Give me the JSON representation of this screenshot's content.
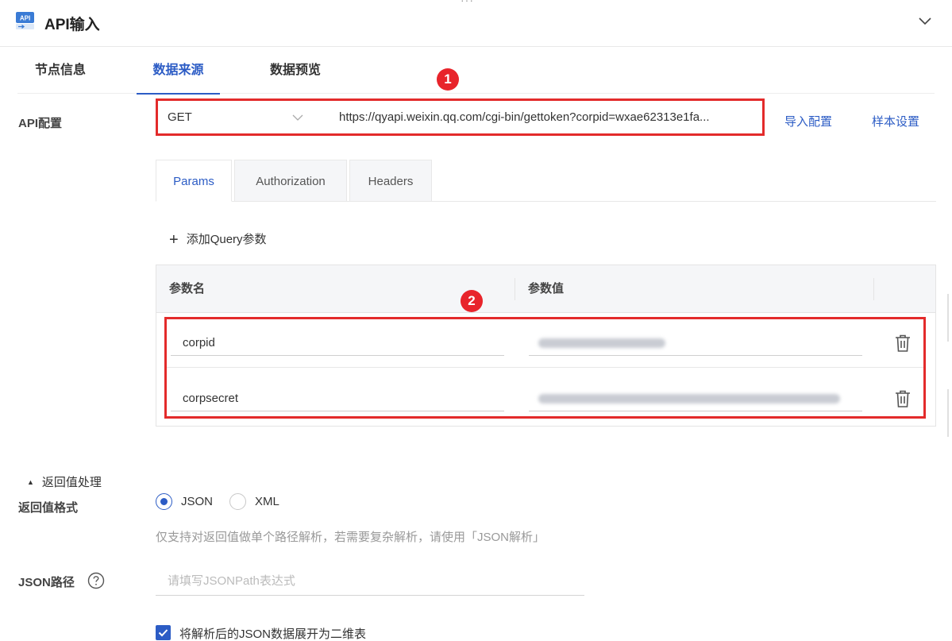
{
  "header": {
    "logo_text": "API",
    "title": "API输入",
    "top_dots": "···"
  },
  "tabs": [
    {
      "label": "节点信息",
      "active": false
    },
    {
      "label": "数据来源",
      "active": true
    },
    {
      "label": "数据预览",
      "active": false
    }
  ],
  "badges": {
    "one": "1",
    "two": "2"
  },
  "api_config": {
    "label": "API配置",
    "method": "GET",
    "url": "https://qyapi.weixin.qq.com/cgi-bin/gettoken?corpid=wxae62313e1fa...",
    "import_label": "导入配置",
    "sample_label": "样本设置"
  },
  "sub_tabs": [
    {
      "label": "Params",
      "active": true
    },
    {
      "label": "Authorization",
      "active": false
    },
    {
      "label": "Headers",
      "active": false
    }
  ],
  "add_query_label": "添加Query参数",
  "param_table": {
    "col_name": "参数名",
    "col_value": "参数值",
    "rows": [
      {
        "name": "corpid"
      },
      {
        "name": "corpsecret"
      }
    ]
  },
  "return_section": {
    "toggle_label": "返回值处理",
    "format_label": "返回值格式",
    "options": [
      {
        "label": "JSON",
        "checked": true
      },
      {
        "label": "XML",
        "checked": false
      }
    ],
    "hint": "仅支持对返回值做单个路径解析，若需要复杂解析，请使用「JSON解析」"
  },
  "json_path": {
    "label": "JSON路径",
    "placeholder": "请填写JSONPath表达式"
  },
  "expand_checkbox": {
    "label": "将解析后的JSON数据展开为二维表",
    "checked": true
  },
  "colors": {
    "accent": "#2c5cc5",
    "highlight_red": "#e32b2b"
  },
  "icons": [
    "api-logo-icon",
    "chevron-down-icon",
    "plus-icon",
    "trash-icon",
    "help-icon",
    "check-icon"
  ]
}
